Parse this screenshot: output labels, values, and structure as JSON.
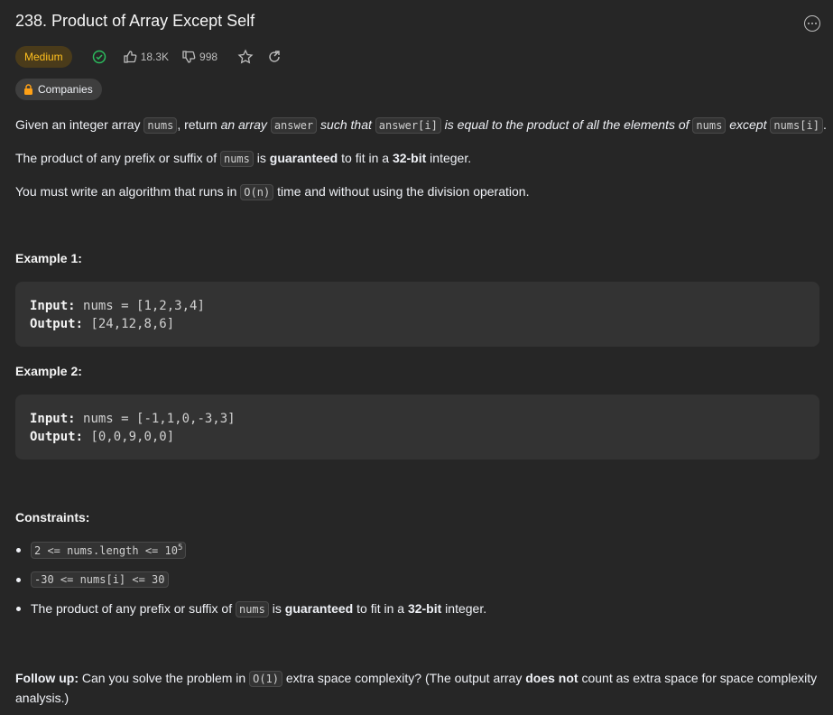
{
  "title": "238. Product of Array Except Self",
  "difficulty": "Medium",
  "likes": "18.3K",
  "dislikes": "998",
  "companies_label": "Companies",
  "colors": {
    "background": "#262626",
    "medium": "#ffc01e",
    "solved": "#2cbb5d"
  },
  "icons": [
    "solved-check-icon",
    "thumbs-up-icon",
    "thumbs-down-icon",
    "star-icon",
    "share-icon",
    "lock-icon",
    "more-icon"
  ],
  "desc": {
    "p1": [
      "Given an integer array ",
      "nums",
      ", return ",
      "an array ",
      "answer",
      " such that ",
      "answer[i]",
      " is equal to the product of all the elements of ",
      "nums",
      " except ",
      "nums[i]",
      "."
    ],
    "p2": [
      "The product of any prefix or suffix of ",
      "nums",
      " is ",
      "guaranteed",
      " to fit in a ",
      "32-bit",
      " integer."
    ],
    "p3": [
      "You must write an algorithm that runs in ",
      "O(n)",
      " time and without using the division operation."
    ]
  },
  "examples": [
    {
      "heading": "Example 1:",
      "input_label": "Input:",
      "input": "nums = [1,2,3,4]",
      "output_label": "Output:",
      "output": "[24,12,8,6]"
    },
    {
      "heading": "Example 2:",
      "input_label": "Input:",
      "input": "nums = [-1,1,0,-3,3]",
      "output_label": "Output:",
      "output": "[0,0,9,0,0]"
    }
  ],
  "constraints_heading": "Constraints:",
  "constraints": {
    "c1": "2 <= nums.length <= 10",
    "c1_sup": "5",
    "c2": "-30 <= nums[i] <= 30",
    "c3": [
      "The product of any prefix or suffix of ",
      "nums",
      " is ",
      "guaranteed",
      " to fit in a ",
      "32-bit",
      " integer."
    ]
  },
  "followup": {
    "label": "Follow up:",
    "t1": " Can you solve the problem in ",
    "code": "O(1)",
    "t2": " extra space complexity? (The output array ",
    "bold": "does not",
    "t3": " count as extra space for space complexity analysis.)"
  }
}
